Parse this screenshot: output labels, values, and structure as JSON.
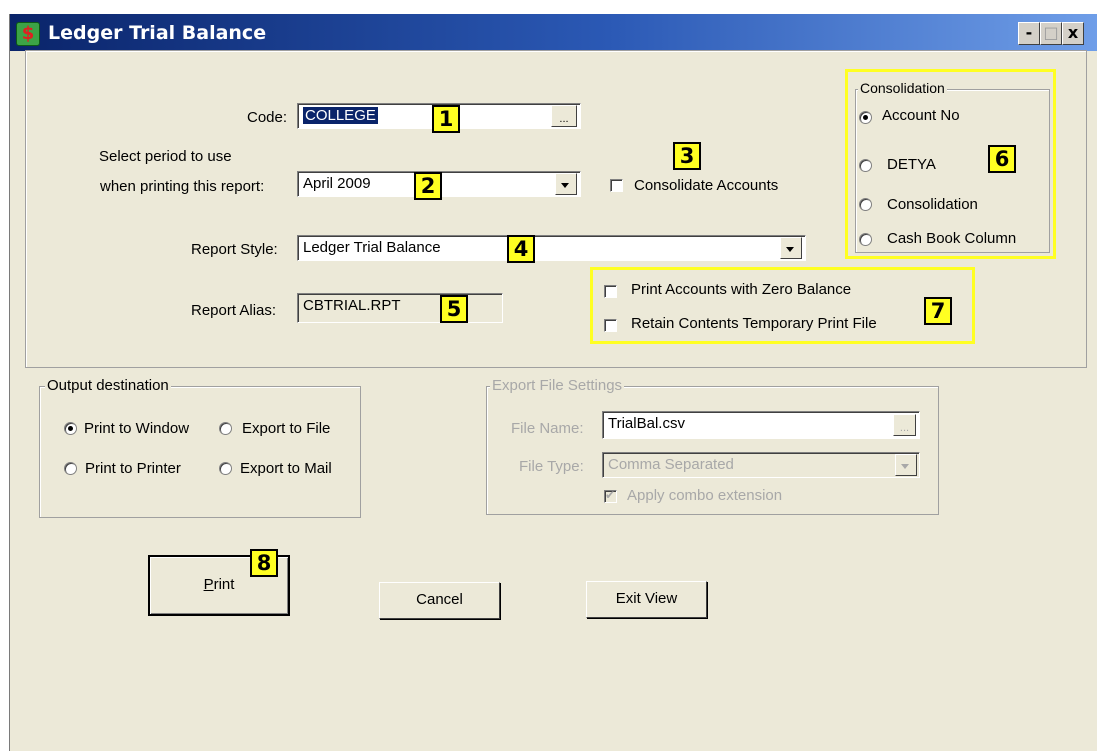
{
  "window": {
    "title": "Ledger Trial Balance",
    "app_icon": "dollar-sign-icon",
    "controls": {
      "minimize": "-",
      "maximize": "□",
      "close": "x"
    }
  },
  "form": {
    "code_label": "Code:",
    "code_value": "COLLEGE",
    "code_browse": "...",
    "period_label_line1": "Select period to use",
    "period_label_line2": "when printing this report:",
    "period_value": "April 2009",
    "consolidate_label": "Consolidate Accounts",
    "consolidate_checked": false,
    "style_label": "Report Style:",
    "style_value": "Ledger Trial Balance",
    "alias_label": "Report Alias:",
    "alias_value": "CBTRIAL.RPT"
  },
  "consolidation": {
    "legend": "Consolidation",
    "options": [
      "Account No",
      "DETYA",
      "Consolidation",
      "Cash Book Column"
    ],
    "selected": "Account No"
  },
  "print_options": {
    "zero_balance_label": "Print Accounts with Zero Balance",
    "retain_label": "Retain Contents Temporary Print File"
  },
  "output": {
    "legend": "Output destination",
    "options": [
      "Print to Window",
      "Export to File",
      "Print to Printer",
      "Export to Mail"
    ],
    "selected": "Print to Window"
  },
  "export": {
    "legend": "Export File Settings",
    "file_name_label": "File Name:",
    "file_name_value": "TrialBal.csv",
    "browse": "...",
    "file_type_label": "File Type:",
    "file_type_value": "Comma Separated",
    "apply_combo_label": "Apply combo extension",
    "apply_combo_checked": true
  },
  "buttons": {
    "print_first": "P",
    "print_rest": "rint",
    "cancel": "Cancel",
    "exit_view": "Exit View"
  },
  "badges": [
    "1",
    "2",
    "3",
    "4",
    "5",
    "6",
    "7",
    "8"
  ],
  "colors": {
    "highlight": "#ffff22",
    "titlebar_start": "#0a246a",
    "titlebar_end": "#6f9ee8",
    "dialog_bg": "#ece9d8"
  }
}
